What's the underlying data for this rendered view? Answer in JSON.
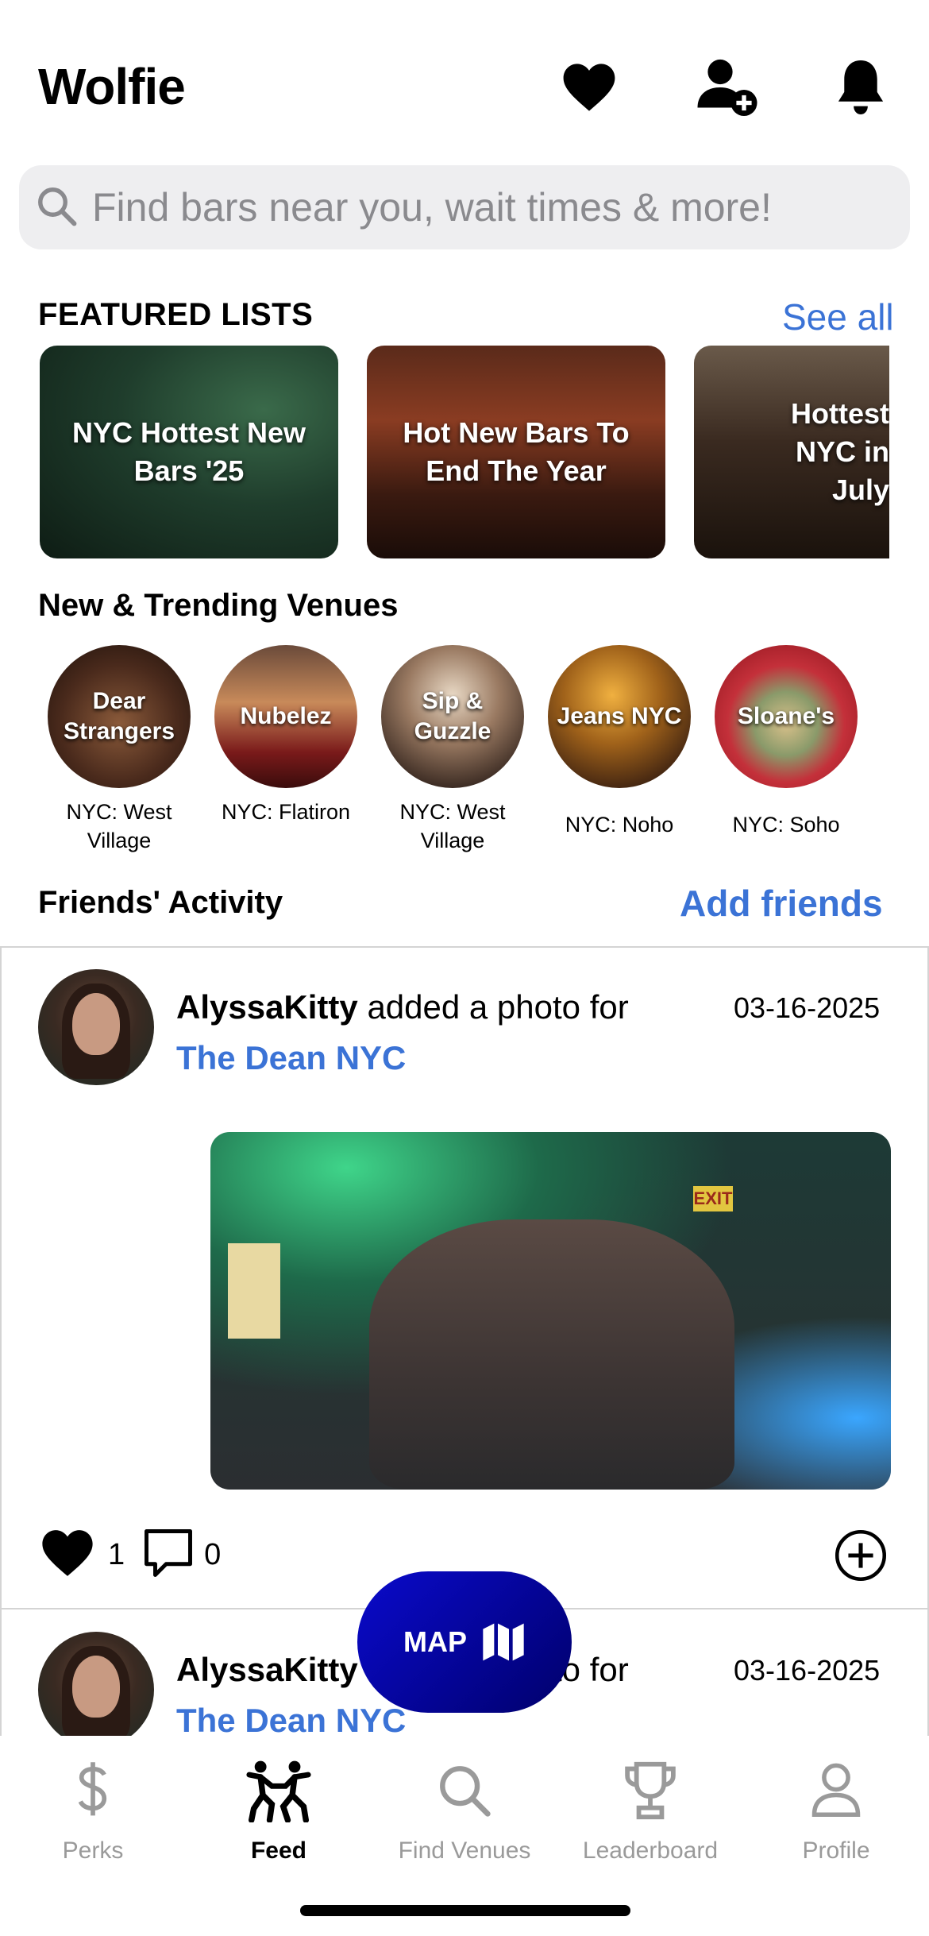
{
  "header": {
    "title": "Wolfie",
    "icons": [
      "heart-icon",
      "add-friend-icon",
      "bell-icon"
    ]
  },
  "search": {
    "placeholder": "Find bars near you, wait times & more!"
  },
  "featured": {
    "title": "FEATURED LISTS",
    "see_all": "See all",
    "cards": [
      {
        "label": "NYC Hottest New Bars '25"
      },
      {
        "label": "Hot New Bars To End The Year"
      },
      {
        "label": "Hottest NYC in July"
      }
    ]
  },
  "trending": {
    "title": "New & Trending Venues",
    "venues": [
      {
        "name": "Dear Strangers",
        "location": "NYC: West Village"
      },
      {
        "name": "Nubelez",
        "location": "NYC: Flatiron"
      },
      {
        "name": "Sip & Guzzle",
        "location": "NYC: West Village"
      },
      {
        "name": "Jeans NYC",
        "location": "NYC: Noho"
      },
      {
        "name": "Sloane's",
        "location": "NYC: Soho"
      }
    ]
  },
  "friends": {
    "title": "Friends' Activity",
    "add_friends": "Add friends",
    "items": [
      {
        "user": "AlyssaKitty",
        "action": "added a photo for",
        "venue": "The Dean NYC",
        "date": "03-16-2025",
        "likes": "1",
        "comments": "0"
      },
      {
        "user": "AlyssaKitty",
        "action": "added a photo for",
        "venue": "The Dean NYC",
        "date": "03-16-2025"
      }
    ]
  },
  "map_button": {
    "label": "MAP"
  },
  "tabs": [
    {
      "label": "Perks",
      "icon": "dollar-icon",
      "active": false
    },
    {
      "label": "Feed",
      "icon": "dancing-icon",
      "active": true
    },
    {
      "label": "Find Venues",
      "icon": "search-icon",
      "active": false
    },
    {
      "label": "Leaderboard",
      "icon": "trophy-icon",
      "active": false
    },
    {
      "label": "Profile",
      "icon": "person-icon",
      "active": false
    }
  ],
  "colors": {
    "accent": "#3b73d6",
    "map_button": "#0a0acc",
    "inactive_tab": "#9a9a9a"
  }
}
